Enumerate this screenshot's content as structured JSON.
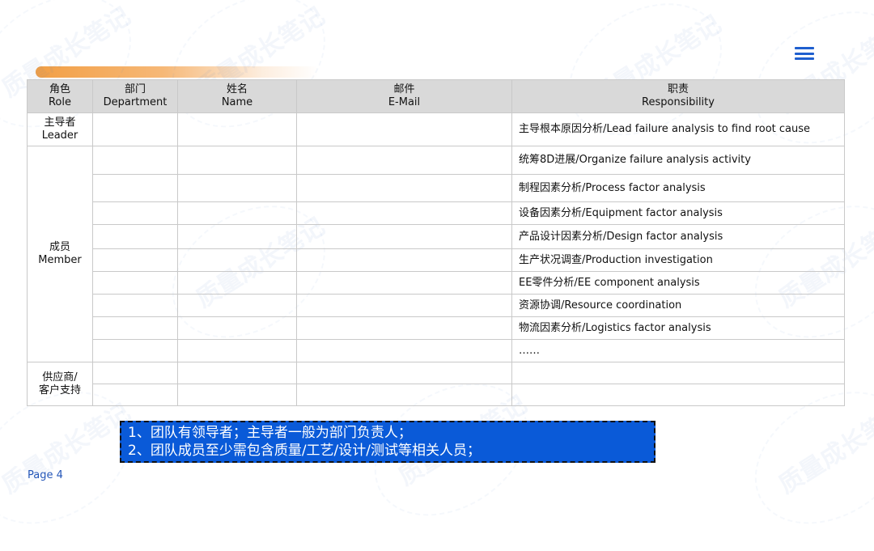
{
  "watermark_text": "质量成长笔记",
  "table": {
    "headers": [
      {
        "cn": "角色",
        "en": "Role"
      },
      {
        "cn": "部门",
        "en": "Department"
      },
      {
        "cn": "姓名",
        "en": "Name"
      },
      {
        "cn": "邮件",
        "en": "E-Mail"
      },
      {
        "cn": "职责",
        "en": "Responsibility"
      }
    ],
    "roles": {
      "leader": {
        "cn": "主导者",
        "en": "Leader"
      },
      "member": {
        "cn": "成员",
        "en": "Member"
      },
      "supplier": {
        "line1": "供应商/",
        "line2": "客户支持"
      }
    },
    "responsibilities": [
      "主导根本原因分析/Lead failure analysis to find root cause",
      "统筹8D进展/Organize failure analysis activity",
      "制程因素分析/Process factor analysis",
      "设备因素分析/Equipment factor analysis",
      "产品设计因素分析/Design factor analysis",
      "生产状况调查/Production investigation",
      "EE零件分析/EE component analysis",
      "资源协调/Resource coordination",
      "物流因素分析/Logistics  factor analysis",
      "……"
    ]
  },
  "notes": [
    "1、团队有领导者；主导者一般为部门负责人；",
    "2、团队成员至少需包含质量/工艺/设计/测试等相关人员；"
  ],
  "page_label": "Page 4",
  "colors": {
    "accent_orange": "#f29f45",
    "note_blue": "#0a5ad8",
    "menu_blue": "#1f5fcf",
    "header_gray": "#d9d9d9"
  }
}
